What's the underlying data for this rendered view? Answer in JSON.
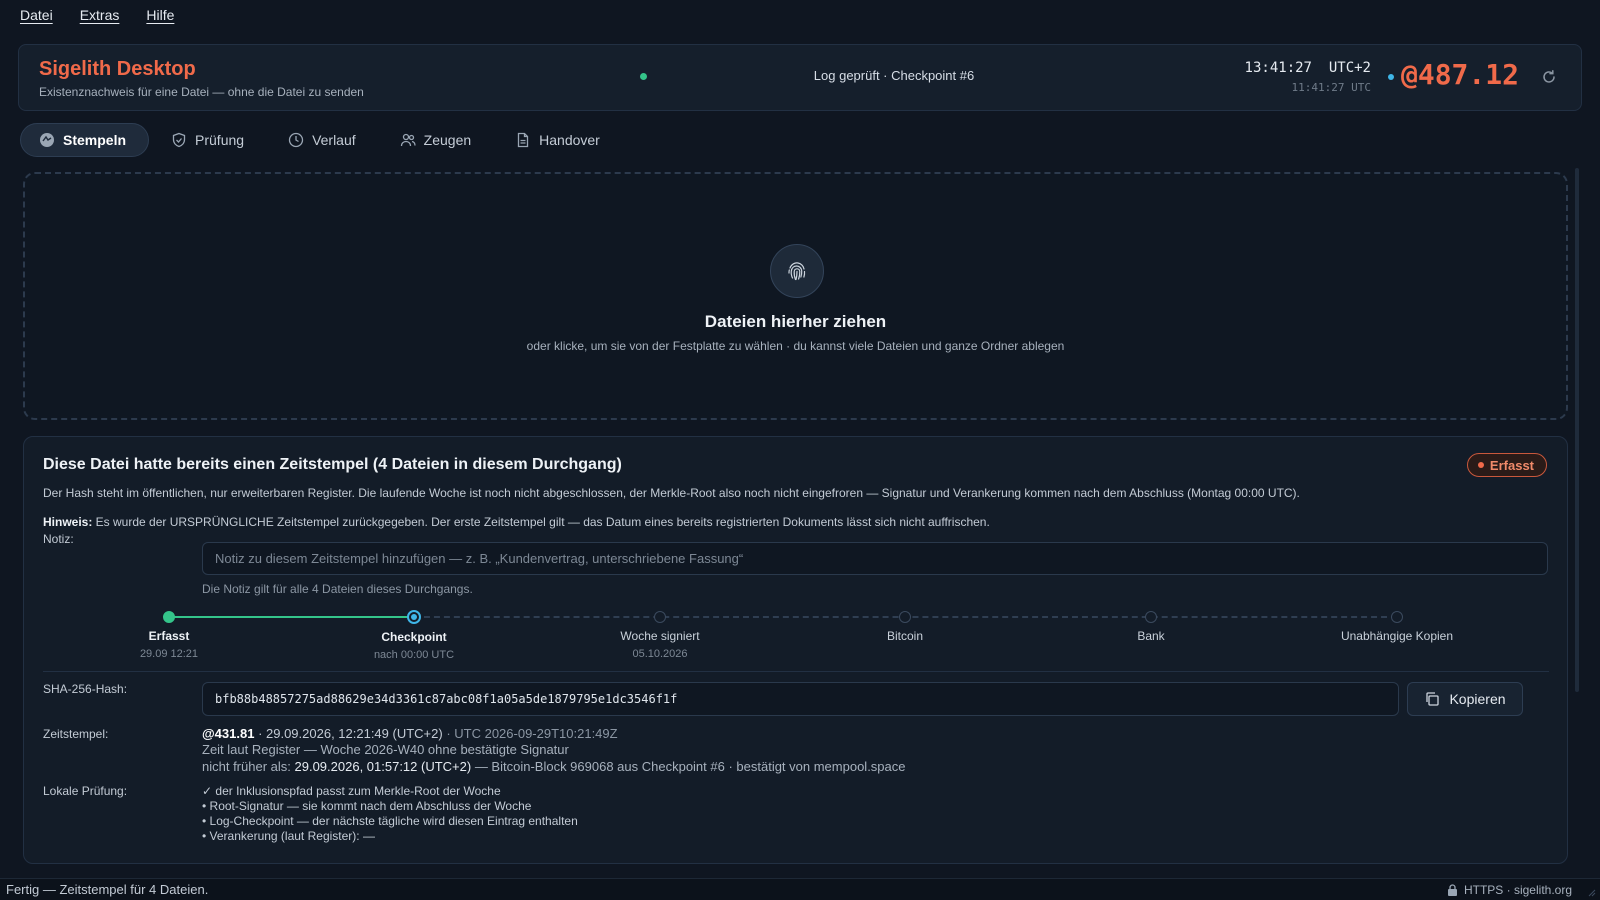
{
  "menu": {
    "file": "Datei",
    "extras": "Extras",
    "help": "Hilfe"
  },
  "header": {
    "title": "Sigelith Desktop",
    "subtitle": "Existenznachweis für eine Datei — ohne die Datei zu senden",
    "log_status": "Log geprüft · Checkpoint #6",
    "time_local": "13:41:27",
    "timezone": "UTC+2",
    "time_utc": "11:41:27 UTC",
    "beat": "@487.12",
    "status_dot_color": "#34c48a",
    "accent_color": "#f06a4a"
  },
  "tabs": [
    {
      "label": "Stempeln",
      "icon": "stamp-icon",
      "active": true
    },
    {
      "label": "Prüfung",
      "icon": "shield-icon"
    },
    {
      "label": "Verlauf",
      "icon": "clock-icon"
    },
    {
      "label": "Zeugen",
      "icon": "users-icon"
    },
    {
      "label": "Handover",
      "icon": "document-icon"
    }
  ],
  "dropzone": {
    "icon": "fingerprint-icon",
    "title": "Dateien hierher ziehen",
    "subtitle": "oder klicke, um sie von der Festplatte zu wählen · du kannst viele Dateien und ganze Ordner ablegen"
  },
  "result": {
    "title": "Diese Datei hatte bereits einen Zeitstempel (4 Dateien in diesem Durchgang)",
    "badge": "Erfasst",
    "description": "Der Hash steht im öffentlichen, nur erweiterbaren Register. Die laufende Woche ist noch nicht abgeschlossen, der Merkle-Root also noch nicht eingefroren — Signatur und Verankerung kommen nach dem Abschluss (Montag 00:00 UTC).",
    "hint_label": "Hinweis:",
    "hint_text": " Es wurde der URSPRÜNGLICHE Zeitstempel zurückgegeben. Der erste Zeitstempel gilt — das Datum eines bereits registrierten Dokuments lässt sich nicht auffrischen.",
    "note_label": "Notiz:",
    "note_value": "",
    "note_placeholder": "Notiz zu diesem Zeitstempel hinzufügen — z. B. „Kundenvertrag, unterschriebene Fassung“",
    "note_help": "Die Notiz gilt für alle 4 Dateien dieses Durchgangs.",
    "timeline": [
      {
        "label": "Erfasst",
        "sub": "29.09 12:21",
        "state": "done"
      },
      {
        "label": "Checkpoint",
        "sub": "nach 00:00 UTC",
        "state": "current"
      },
      {
        "label": "Woche signiert",
        "sub": "05.10.2026",
        "state": "pending"
      },
      {
        "label": "Bitcoin",
        "sub": "",
        "state": "pending"
      },
      {
        "label": "Bank",
        "sub": "",
        "state": "pending"
      },
      {
        "label": "Unabhängige Kopien",
        "sub": "",
        "state": "pending"
      }
    ],
    "hash_label": "SHA-256-Hash:",
    "hash": "bfb88b48857275ad88629e34d3361c87abc08f1a05a5de1879795e1dc3546f1f",
    "copy_label": "Kopieren",
    "timestamp_label": "Zeitstempel:",
    "timestamp": {
      "beat": "@431.81",
      "local": " · 29.09.2026, 12:21:49 (UTC+2)",
      "utc": " · UTC 2026-09-29T10:21:49Z",
      "line2": "Zeit laut Register — Woche 2026-W40 ohne bestätigte Signatur",
      "line3_prefix": "nicht früher als: ",
      "line3_value": "29.09.2026, 01:57:12 (UTC+2)",
      "line3_suffix": " — Bitcoin-Block 969068 aus Checkpoint #6 · bestätigt von mempool.space"
    },
    "local_check_label": "Lokale Prüfung:",
    "local_checks": [
      "✓ der Inklusionspfad passt zum Merkle-Root der Woche",
      "• Root-Signatur — sie kommt nach dem Abschluss der Woche",
      "• Log-Checkpoint — der nächste tägliche wird diesen Eintrag enthalten",
      "• Verankerung (laut Register): —"
    ]
  },
  "statusbar": {
    "text": "Fertig — Zeitstempel für 4 Dateien.",
    "connection": "HTTPS · sigelith.org"
  }
}
